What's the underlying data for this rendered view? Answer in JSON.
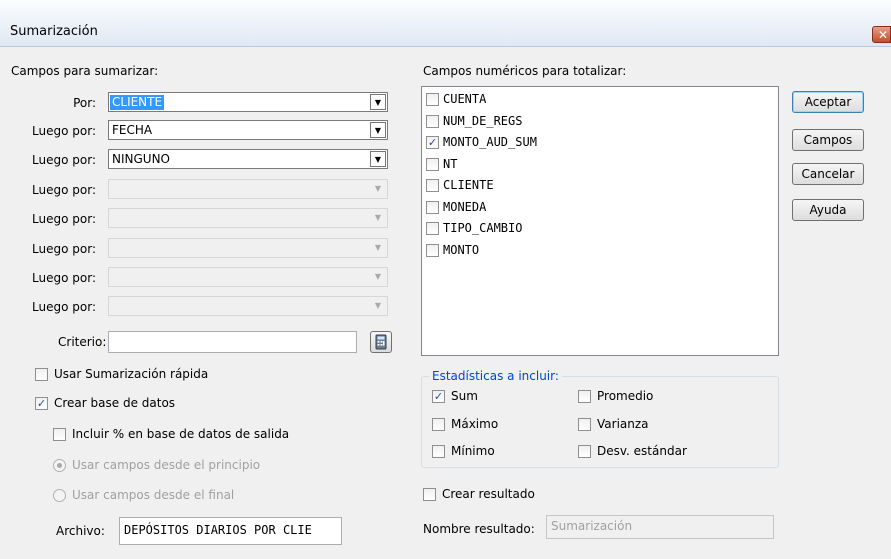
{
  "window": {
    "title": "Sumarización",
    "close_glyph": "✕"
  },
  "left": {
    "section_label": "Campos para sumarizar:",
    "rows": [
      {
        "label": "Por:",
        "value": "CLIENTE",
        "enabled": true,
        "selected": true
      },
      {
        "label": "Luego por:",
        "value": "FECHA",
        "enabled": true,
        "selected": false
      },
      {
        "label": "Luego por:",
        "value": "NINGUNO",
        "enabled": true,
        "selected": false
      },
      {
        "label": "Luego por:",
        "value": "",
        "enabled": false
      },
      {
        "label": "Luego por:",
        "value": "",
        "enabled": false
      },
      {
        "label": "Luego por:",
        "value": "",
        "enabled": false
      },
      {
        "label": "Luego por:",
        "value": "",
        "enabled": false
      },
      {
        "label": "Luego por:",
        "value": "",
        "enabled": false
      }
    ],
    "criterio_label": "Criterio:",
    "criterio_value": "",
    "calc_icon": "calculator-icon",
    "usar_rapida": {
      "label": "Usar Sumarización rápida",
      "checked": false
    },
    "crear_bd": {
      "label": "Crear base de datos",
      "checked": true
    },
    "incluir_pct": {
      "label": "Incluir % en base de datos de salida",
      "checked": false
    },
    "radio_principio": {
      "label": "Usar campos desde el principio",
      "checked": true
    },
    "radio_final": {
      "label": "Usar campos desde el final",
      "checked": false
    },
    "archivo_label": "Archivo:",
    "archivo_value": "DEPÓSITOS DIARIOS POR CLIE"
  },
  "right": {
    "section_label": "Campos numéricos para totalizar:",
    "fields": [
      {
        "name": "CUENTA",
        "checked": false
      },
      {
        "name": "NUM_DE_REGS",
        "checked": false
      },
      {
        "name": "MONTO_AUD_SUM",
        "checked": true
      },
      {
        "name": "NT",
        "checked": false
      },
      {
        "name": "CLIENTE",
        "checked": false
      },
      {
        "name": "MONEDA",
        "checked": false
      },
      {
        "name": "TIPO_CAMBIO",
        "checked": false
      },
      {
        "name": "MONTO",
        "checked": false
      }
    ],
    "stats_label": "Estadísticas a incluir:",
    "stats": {
      "sum": {
        "label": "Sum",
        "checked": true
      },
      "maximo": {
        "label": "Máximo",
        "checked": false
      },
      "minimo": {
        "label": "Mínimo",
        "checked": false
      },
      "promedio": {
        "label": "Promedio",
        "checked": false
      },
      "varianza": {
        "label": "Varianza",
        "checked": false
      },
      "desv": {
        "label": "Desv. estándar",
        "checked": false
      }
    },
    "crear_resultado": {
      "label": "Crear resultado",
      "checked": false
    },
    "nombre_label": "Nombre resultado:",
    "nombre_value": "Sumarización"
  },
  "buttons": {
    "aceptar": "Aceptar",
    "campos": "Campos",
    "cancelar": "Cancelar",
    "ayuda": "Ayuda"
  },
  "colors": {
    "selection": "#3399ff",
    "group_title": "#0046d5",
    "disabled_text": "#a0a0a0"
  }
}
